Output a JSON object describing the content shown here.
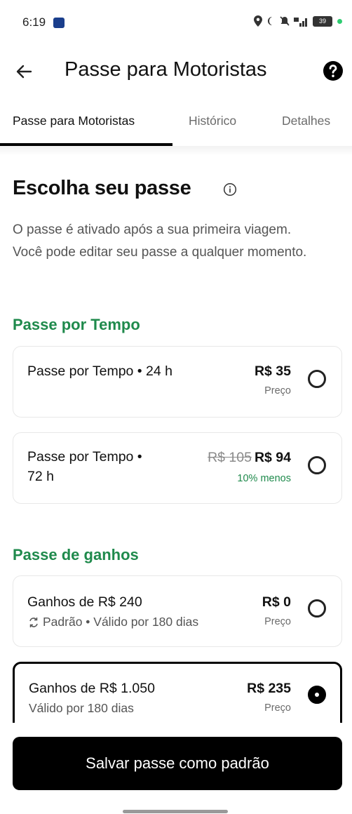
{
  "status": {
    "time": "6:19"
  },
  "header": {
    "title": "Passe para Motoristas"
  },
  "tabs": [
    {
      "label": "Passe para Motoristas"
    },
    {
      "label": "Histórico"
    },
    {
      "label": "Detalhes"
    }
  ],
  "main": {
    "heading": "Escolha seu passe",
    "intro": "O passe é ativado após a sua primeira viagem. Você pode editar seu passe a qualquer momento.",
    "groups": [
      {
        "title": "Passe por Tempo",
        "cards": [
          {
            "name": "Passe por Tempo • 24 h",
            "price": "R$ 35",
            "caption": "Preço",
            "selected": false
          },
          {
            "name": "Passe por Tempo •",
            "name_line2": "72 h",
            "old_price": "R$ 105",
            "price": "R$ 94",
            "caption": "10% menos",
            "selected": false
          }
        ]
      },
      {
        "title": "Passe de ganhos",
        "cards": [
          {
            "name": "Ganhos de R$ 240",
            "sub": "Padrão • Válido por 180 dias",
            "price": "R$ 0",
            "caption": "Preço",
            "selected": false
          },
          {
            "name": "Ganhos de R$ 1.050",
            "sub": "Válido por 180 dias",
            "price": "R$ 235",
            "caption": "Preço",
            "selected": true
          }
        ]
      }
    ]
  },
  "footer": {
    "save_label": "Salvar passe como padrão"
  },
  "colors": {
    "accent_green": "#1f8a4c",
    "primary": "#000000"
  }
}
